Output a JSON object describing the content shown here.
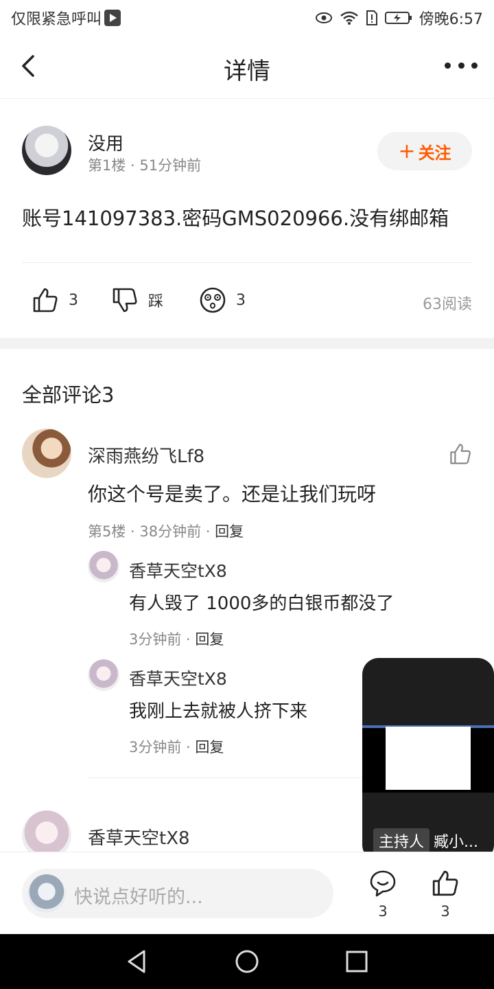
{
  "status_bar": {
    "left_text": "仅限紧急呼叫",
    "right_text": "傍晚6:57"
  },
  "header": {
    "title": "详情"
  },
  "post": {
    "author": "没用",
    "meta": "第1楼 · 51分钟前",
    "follow_label": "关注",
    "content": "账号141097383.密码GMS020966.没有绑邮箱",
    "likes": "3",
    "dislike_label": "踩",
    "reactions": "3",
    "reads": "63阅读"
  },
  "comments": {
    "title": "全部评论3",
    "items": [
      {
        "author": "深雨燕纷飞Lf8",
        "text": "你这个号是卖了。还是让我们玩呀",
        "meta": "第5楼 · 38分钟前 · ",
        "reply_label": "回复",
        "replies": [
          {
            "author": "香草天空tX8",
            "text": "有人毁了 1000多的白银币都没了",
            "meta": "3分钟前 · ",
            "reply_label": "回复"
          },
          {
            "author": "香草天空tX8",
            "text": "我刚上去就被人挤下来",
            "meta": "3分钟前 · ",
            "reply_label": "回复"
          }
        ]
      },
      {
        "author": "香草天空tX8"
      }
    ]
  },
  "pip_window": {
    "host_label": "主持人",
    "name": "臧小..."
  },
  "bottom_bar": {
    "placeholder": "快说点好听的...",
    "comment_count": "3",
    "like_count": "3"
  },
  "colors": {
    "accent": "#ff5a00",
    "meta_gray": "#888888",
    "divider": "#eeeeee"
  }
}
